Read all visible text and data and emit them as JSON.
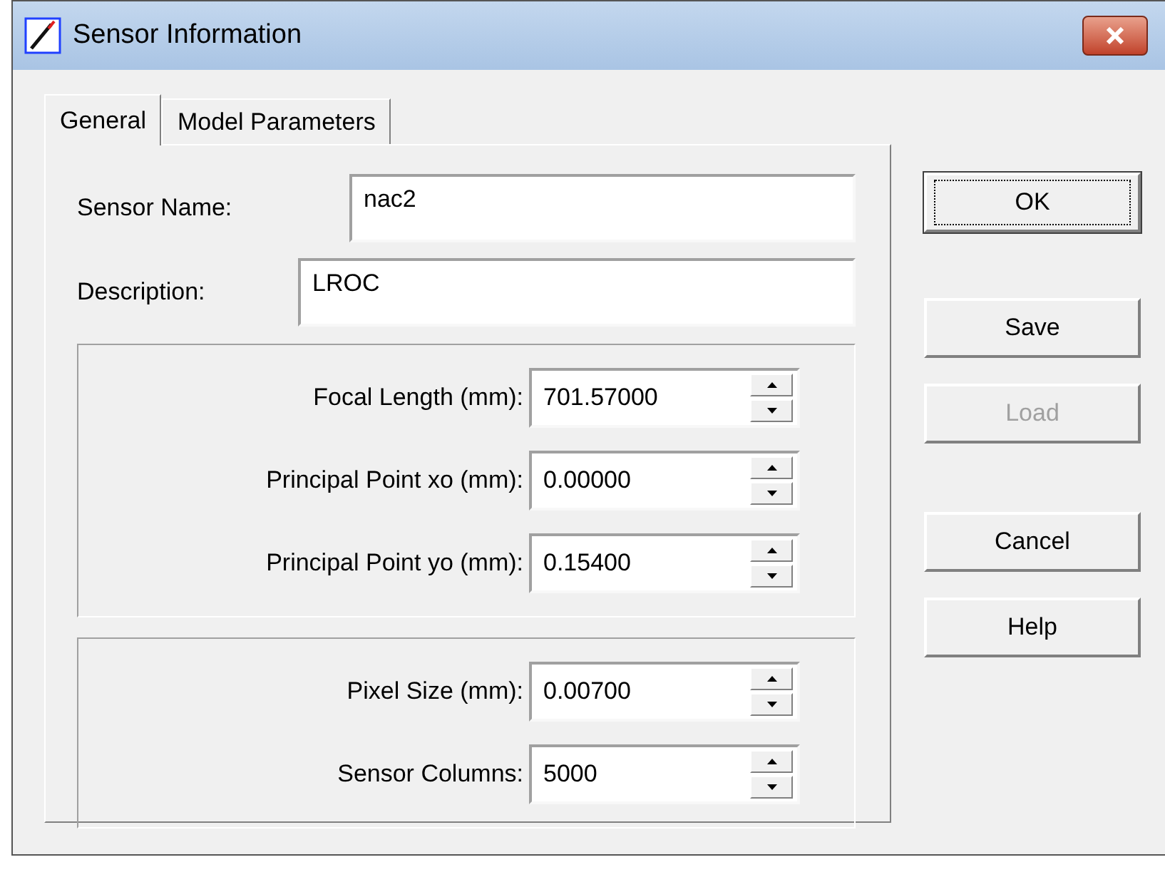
{
  "window": {
    "title": "Sensor Information"
  },
  "tabs": [
    {
      "label": "General",
      "selected": true
    },
    {
      "label": "Model Parameters",
      "selected": false
    }
  ],
  "fields": [
    {
      "label": "Sensor Name:",
      "value": "nac2"
    },
    {
      "label": "Description:",
      "value": "LROC"
    }
  ],
  "groups": [
    {
      "spinners": [
        {
          "label": "Focal Length (mm):",
          "value": "701.57000"
        },
        {
          "label": "Principal Point xo (mm):",
          "value": "0.00000"
        },
        {
          "label": "Principal Point yo (mm):",
          "value": "0.15400"
        }
      ]
    },
    {
      "spinners": [
        {
          "label": "Pixel Size (mm):",
          "value": "0.00700"
        },
        {
          "label": "Sensor Columns:",
          "value": "5000"
        }
      ]
    }
  ],
  "buttons": [
    {
      "label": "OK",
      "default": true,
      "disabled": false
    },
    {
      "label": "Save",
      "default": false,
      "disabled": false
    },
    {
      "label": "Load",
      "default": false,
      "disabled": true
    },
    {
      "label": "Cancel",
      "default": false,
      "disabled": false
    },
    {
      "label": "Help",
      "default": false,
      "disabled": false
    }
  ]
}
